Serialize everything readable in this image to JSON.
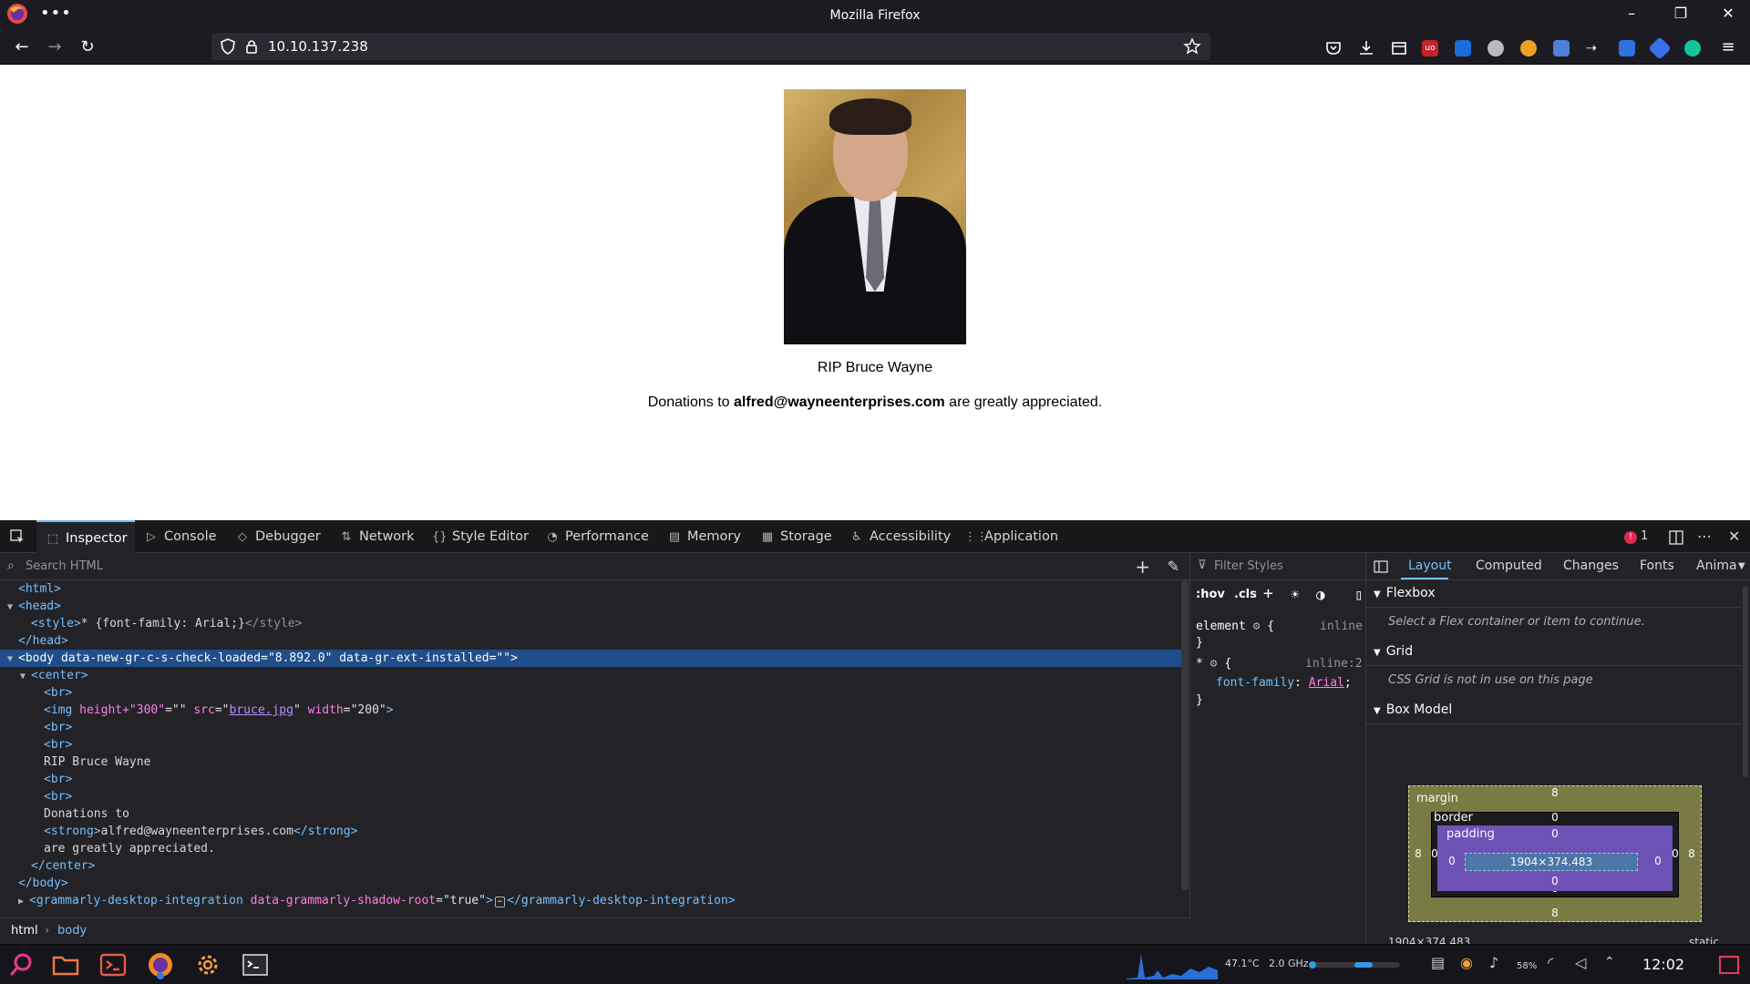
{
  "window": {
    "title": "Mozilla Firefox",
    "menu_dots": "•••",
    "minimize": "–",
    "restore": "❐",
    "close": "✕"
  },
  "nav": {
    "url": "10.10.137.238",
    "back": "←",
    "forward": "→",
    "reload": "↻",
    "menu": "≡"
  },
  "page": {
    "caption": "RIP Bruce Wayne",
    "donation_prefix": "Donations to ",
    "donation_email": "alfred@wayneenterprises.com",
    "donation_suffix": " are greatly appreciated."
  },
  "devtools": {
    "tabs": [
      {
        "label": "Inspector",
        "icon": "⬚"
      },
      {
        "label": "Console",
        "icon": "▷"
      },
      {
        "label": "Debugger",
        "icon": "◇"
      },
      {
        "label": "Network",
        "icon": "⇅"
      },
      {
        "label": "Style Editor",
        "icon": "{}"
      },
      {
        "label": "Performance",
        "icon": "◔"
      },
      {
        "label": "Memory",
        "icon": "▤"
      },
      {
        "label": "Storage",
        "icon": "▦"
      },
      {
        "label": "Accessibility",
        "icon": "♿"
      },
      {
        "label": "Application",
        "icon": "⋮⋮"
      }
    ],
    "error_count": "1",
    "search_placeholder": "Search HTML",
    "markup": {
      "l1": "<html>",
      "l2": "<head>",
      "l3_tag_open": "<style>",
      "l3_text": "* {font-family: Arial;}",
      "l3_tag_close": "</style>",
      "l4": "</head>",
      "l5_open": "<body ",
      "l5_a1": "data-new-gr-c-s-check-loaded",
      "l5_v1": "=\"8.892.0\"",
      "l5_a2": " data-gr-ext-installed",
      "l5_v2": "=\"\"",
      "l5_close": ">",
      "l6": "<center>",
      "l7": "<br>",
      "l8_open": "<img ",
      "l8_a1": "height+\"300\"",
      "l8_v1": "=\"\"",
      "l8_a2": " src",
      "l8_v2a": "=\"",
      "l8_link": "bruce.jpg",
      "l8_v2b": "\"",
      "l8_a3": " width",
      "l8_v3": "=\"200\"",
      "l8_close": ">",
      "l9": "<br>",
      "l10": "<br>",
      "l11": "RIP Bruce Wayne",
      "l12": "<br>",
      "l13": "<br>",
      "l14": "Donations to",
      "l15_open": "<strong>",
      "l15_text": "alfred@wayneenterprises.com",
      "l15_close": "</strong>",
      "l16": "are greatly appreciated.",
      "l17": "</center>",
      "l18": "</body>",
      "l19_open": "<grammarly-desktop-integration ",
      "l19_a": "data-grammarly-shadow-root",
      "l19_v": "=\"true\"",
      "l19_close": ">",
      "l19_ellipsis": "⋯",
      "l19_end": "</grammarly-desktop-integration>"
    },
    "breadcrumb": [
      "html",
      "body"
    ],
    "breadcrumb_sep": "›",
    "rules": {
      "filter_placeholder": "Filter Styles",
      "hov": ":hov",
      "cls": ".cls",
      "element_sel": "element",
      "brace_open": "{",
      "brace_close": "}",
      "inline": "inline",
      "star_sel": "*",
      "inline2": "inline:2",
      "prop": "font-family",
      "colon": ": ",
      "value": "Arial",
      "semi": ";"
    },
    "layout": {
      "tabs": [
        "Layout",
        "Computed",
        "Changes",
        "Fonts",
        "Anima"
      ],
      "flexbox": "Flexbox",
      "flexbox_note": "Select a Flex container or item to continue.",
      "grid": "Grid",
      "grid_note": "CSS Grid is not in use on this page",
      "boxmodel": "Box Model",
      "margin_label": "margin",
      "border_label": "border",
      "padding_label": "padding",
      "content_size": "1904×374.483",
      "margin_top": "8",
      "margin_bottom": "8",
      "margin_left": "8",
      "margin_right": "8",
      "border_top": "0",
      "border_bottom": "0",
      "border_left": "0",
      "border_right": "0",
      "padding_top": "0",
      "padding_bottom": "0",
      "padding_left": "0",
      "padding_right": "0",
      "footer_size": "1904×374.483",
      "position": "static"
    }
  },
  "taskbar": {
    "temp": "47.1°C",
    "freq": "2.0 GHz",
    "battery": "58%",
    "time": "12:02"
  },
  "colors": {
    "accent": "#75bfff",
    "selection": "#204e8a",
    "tag": "#75bfff",
    "attr": "#ff7de9"
  }
}
